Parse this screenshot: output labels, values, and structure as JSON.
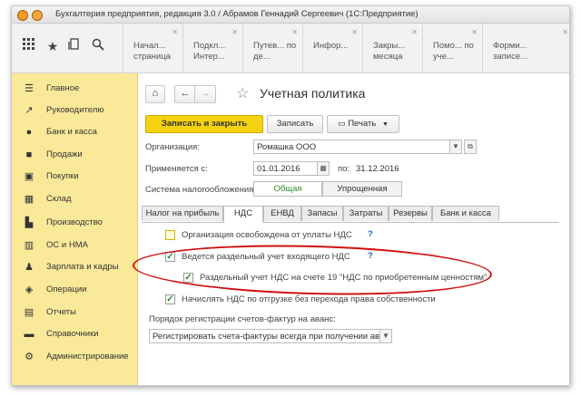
{
  "window": {
    "title": "Бухгалтерия предприятия, редакция 3.0 / Абрамов Геннадий Сергеевич  (1С:Предприятие)"
  },
  "toolbar": {
    "icons": [
      "apps-grid-icon",
      "star-icon",
      "history-icon",
      "search-icon"
    ]
  },
  "open_tabs": [
    {
      "label": "Начал... страница"
    },
    {
      "label": "Подкл... Интер..."
    },
    {
      "label": "Путев... по де..."
    },
    {
      "label": "Инфор..."
    },
    {
      "label": "Закры... месяца"
    },
    {
      "label": "Помо... по уче..."
    },
    {
      "label": "Форми... записе..."
    }
  ],
  "sidebar": {
    "items": [
      {
        "label": "Главное",
        "icon": "menu-icon"
      },
      {
        "label": "Руководителю",
        "icon": "chart-icon"
      },
      {
        "label": "Банк и касса",
        "icon": "ruble-icon"
      },
      {
        "label": "Продажи",
        "icon": "bag-icon"
      },
      {
        "label": "Покупки",
        "icon": "cart-icon"
      },
      {
        "label": "Склад",
        "icon": "warehouse-icon"
      },
      {
        "label": "Производство",
        "icon": "factory-icon"
      },
      {
        "label": "ОС и НМА",
        "icon": "building-icon"
      },
      {
        "label": "Зарплата и кадры",
        "icon": "people-icon"
      },
      {
        "label": "Операции",
        "icon": "operations-icon"
      },
      {
        "label": "Отчеты",
        "icon": "reports-icon"
      },
      {
        "label": "Справочники",
        "icon": "book-icon"
      },
      {
        "label": "Администрирование",
        "icon": "gear-icon"
      }
    ]
  },
  "form": {
    "title": "Учетная политика",
    "save_close_label": "Записать и закрыть",
    "save_label": "Записать",
    "print_label": "Печать",
    "org_label": "Организация:",
    "org_value": "Ромашка ООО",
    "applies_label": "Применяется с:",
    "applies_value": "01.01.2016",
    "to_label": "по:",
    "to_value": "31.12.2016",
    "tax_system_label": "Система налогообложения:",
    "tax_general": "Общая",
    "tax_simplified": "Упрощенная",
    "tabs": [
      "Налог на прибыль",
      "НДС",
      "ЕНВД",
      "Запасы",
      "Затраты",
      "Резервы",
      "Банк и касса"
    ],
    "active_tab": "НДС",
    "vat": {
      "exempt_label": "Организация освобождена от уплаты НДС",
      "exempt_checked": false,
      "separate_label": "Ведется раздельный учет входящего НДС",
      "separate_checked": true,
      "account19_label": "Раздельный учет НДС на счете 19 \"НДС по приобретенным ценностям\"",
      "account19_checked": true,
      "shipment_label": "Начислять НДС по отгрузке без перехода права собственности",
      "shipment_checked": true,
      "invoice_order_label": "Порядок регистрации счетов-фактур на аванс:",
      "invoice_order_value": "Регистрировать счета-фактуры всегда при получении аванса",
      "help": "?"
    }
  }
}
